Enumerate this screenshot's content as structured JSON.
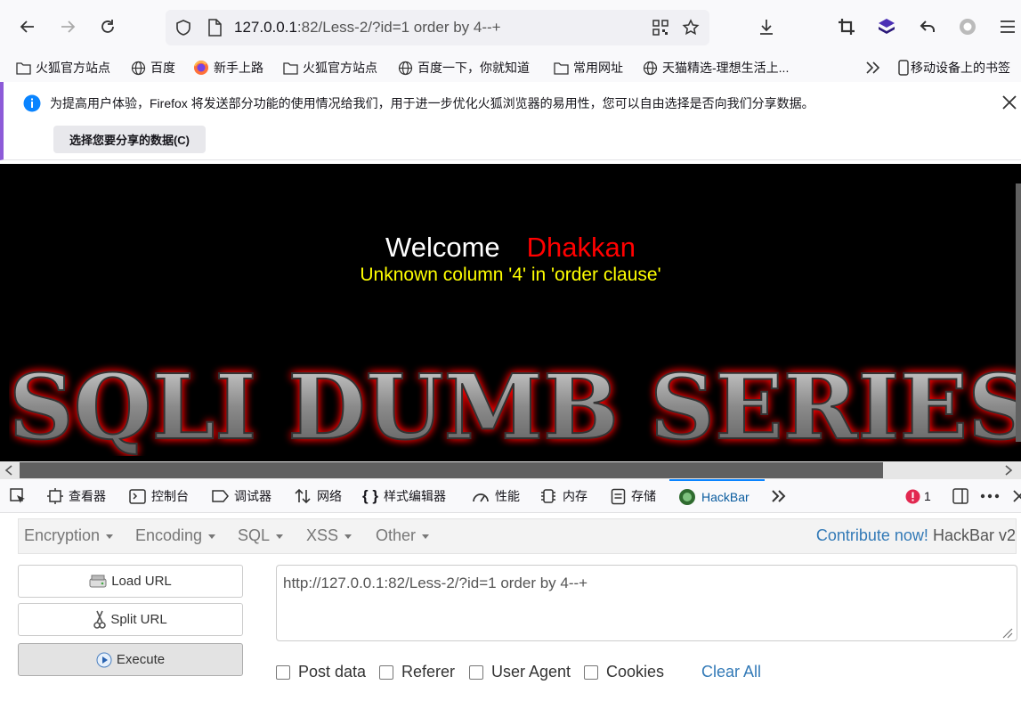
{
  "toolbar": {
    "url_host": "127.0.0.1",
    "url_rest": ":82/Less-2/?id=1 order by 4--+"
  },
  "bookmarks": [
    {
      "label": "火狐官方站点"
    },
    {
      "label": "百度"
    },
    {
      "label": "新手上路"
    },
    {
      "label": "火狐官方站点"
    },
    {
      "label": "百度一下，你就知道"
    },
    {
      "label": "常用网址"
    },
    {
      "label": "天猫精选-理想生活上..."
    },
    {
      "label": "移动设备上的书签"
    }
  ],
  "notice": {
    "text": "为提高用户体验，Firefox 将发送部分功能的使用情况给我们，用于进一步优化火狐浏览器的易用性，您可以自由选择是否向我们分享数据。",
    "button": "选择您要分享的数据(C)"
  },
  "page": {
    "welcome": "Welcome",
    "name": "Dhakkan",
    "error": "Unknown column '4' in 'order clause'",
    "banner": "SQLI DUMB SERIES"
  },
  "devtools": {
    "tabs": [
      "查看器",
      "控制台",
      "调试器",
      "网络",
      "样式编辑器",
      "性能",
      "内存",
      "存储",
      "HackBar"
    ],
    "error_count": "1"
  },
  "hackbar": {
    "menus": [
      "Encryption",
      "Encoding",
      "SQL",
      "XSS",
      "Other"
    ],
    "contribute_link": "Contribute now!",
    "version": "HackBar v2",
    "load_url": "Load URL",
    "split_url": "Split URL",
    "execute": "Execute",
    "url_value": "http://127.0.0.1:82/Less-2/?id=1 order by 4--+",
    "options": [
      "Post data",
      "Referer",
      "User Agent",
      "Cookies"
    ],
    "clear_all": "Clear All"
  },
  "colors": {
    "accent_blue": "#0a84ff",
    "link_blue": "#337ab7",
    "error_yellow": "#ffff00",
    "name_red": "#ff0000"
  }
}
